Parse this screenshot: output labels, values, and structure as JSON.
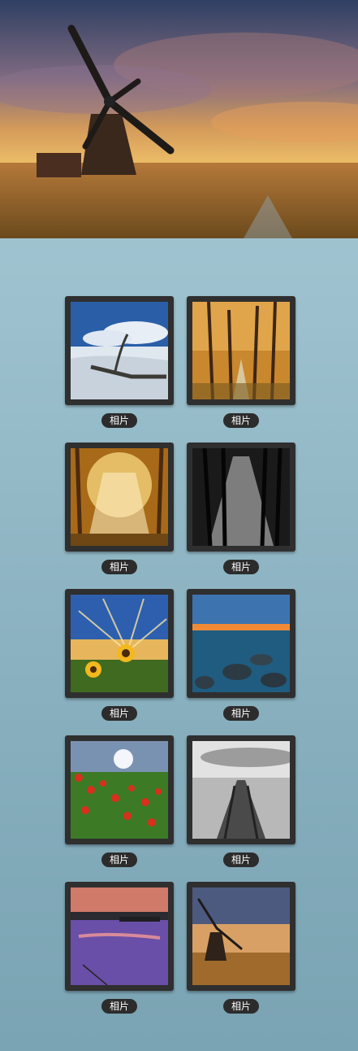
{
  "hero": {
    "icon": "windmill-photo"
  },
  "gallery": {
    "items": [
      {
        "label": "相片",
        "icon": "driftwood-beach-photo"
      },
      {
        "label": "相片",
        "icon": "autumn-forest-path-photo"
      },
      {
        "label": "相片",
        "icon": "sunlit-forest-photo"
      },
      {
        "label": "相片",
        "icon": "bw-forest-light-photo"
      },
      {
        "label": "相片",
        "icon": "sunflower-sunset-photo"
      },
      {
        "label": "相片",
        "icon": "rocky-shore-sunset-photo"
      },
      {
        "label": "相片",
        "icon": "poppy-field-photo"
      },
      {
        "label": "相片",
        "icon": "bw-pier-photo"
      },
      {
        "label": "相片",
        "icon": "purple-lake-dusk-photo"
      },
      {
        "label": "相片",
        "icon": "windmill-thumbnail-photo"
      }
    ]
  }
}
